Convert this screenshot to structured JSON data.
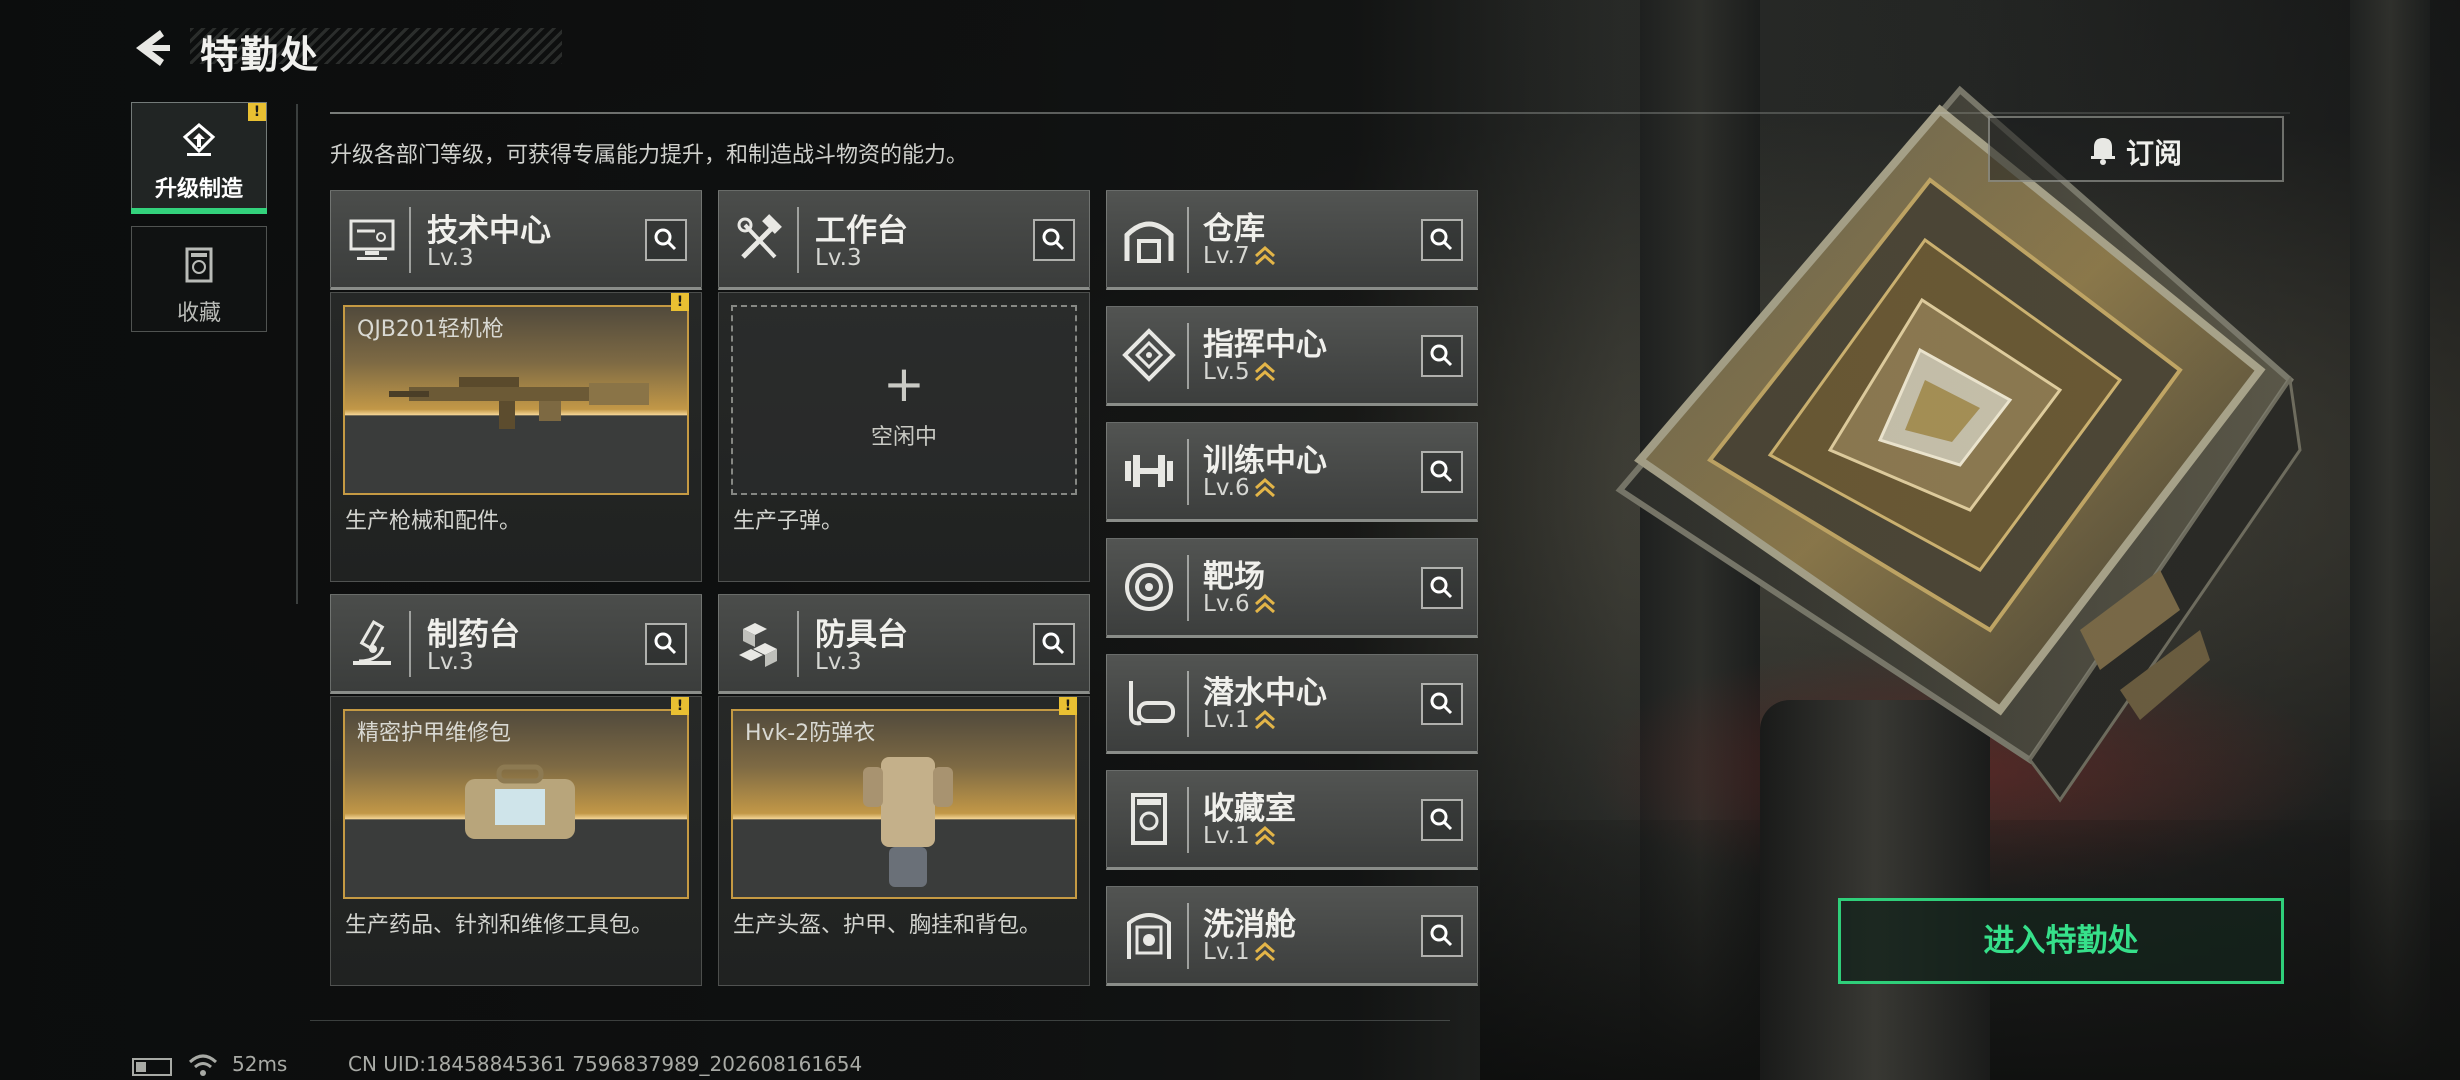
{
  "header": {
    "title": "特勤处",
    "subtitle": "升级各部门等级，可获得专属能力提升，和制造战斗物资的能力。"
  },
  "side_tabs": [
    {
      "label": "升级制造",
      "active": true,
      "alert": "!"
    },
    {
      "label": "收藏",
      "active": false
    }
  ],
  "workshops": [
    {
      "name": "技术中心",
      "level": "Lv.3",
      "slot_item": "QJB201轻机枪",
      "slot_alert": "!",
      "description": "生产枪械和配件。"
    },
    {
      "name": "工作台",
      "level": "Lv.3",
      "slot_plus": "+",
      "slot_status": "空闲中",
      "description": "生产子弹。"
    },
    {
      "name": "制药台",
      "level": "Lv.3",
      "slot_item": "精密护甲维修包",
      "slot_alert": "!",
      "description": "生产药品、针剂和维修工具包。"
    },
    {
      "name": "防具台",
      "level": "Lv.3",
      "slot_item": "Hvk-2防弹衣",
      "slot_alert": "!",
      "description": "生产头盔、护甲、胸挂和背包。"
    }
  ],
  "departments": [
    {
      "name": "仓库",
      "level": "Lv.7",
      "icon": "warehouse-icon"
    },
    {
      "name": "指挥中心",
      "level": "Lv.5",
      "icon": "command-center-icon"
    },
    {
      "name": "训练中心",
      "level": "Lv.6",
      "icon": "dumbbell-icon"
    },
    {
      "name": "靶场",
      "level": "Lv.6",
      "icon": "target-icon"
    },
    {
      "name": "潜水中心",
      "level": "Lv.1",
      "icon": "diving-mask-icon"
    },
    {
      "name": "收藏室",
      "level": "Lv.1",
      "icon": "collection-room-icon"
    },
    {
      "name": "洗消舱",
      "level": "Lv.1",
      "icon": "decontamination-icon"
    }
  ],
  "actions": {
    "subscribe": "订阅",
    "enter": "进入特勤处"
  },
  "status": {
    "ping": "52ms",
    "uid": "CN UID:18458845361 7596837989_202608161654"
  },
  "colors": {
    "accent_green": "#33d27c",
    "gold": "#c59a43",
    "alert_yellow": "#e9c032"
  }
}
